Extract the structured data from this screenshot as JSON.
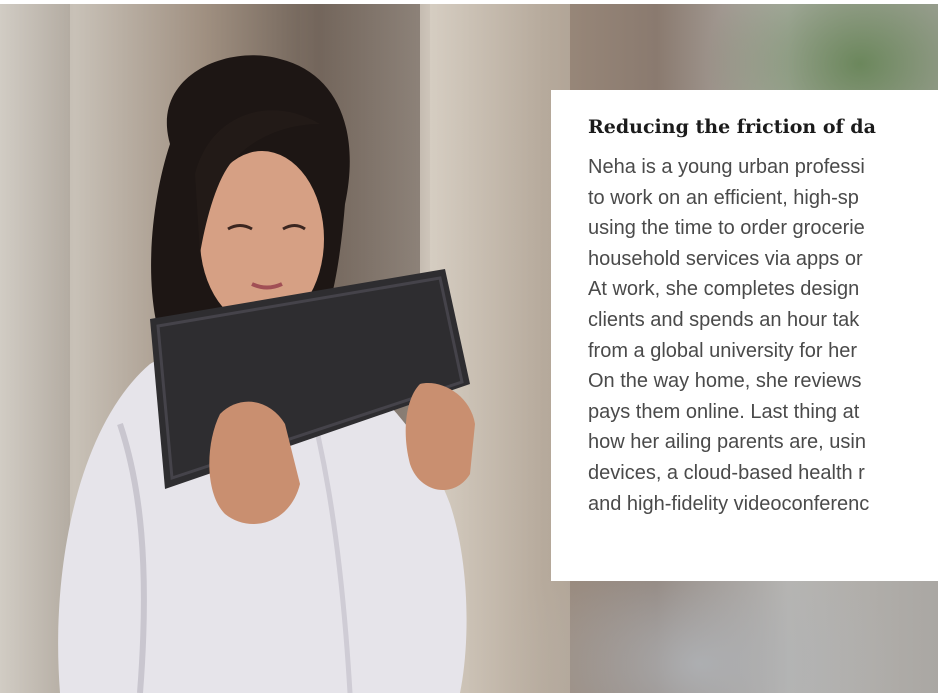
{
  "card": {
    "title": "Reducing the friction of da",
    "lines": [
      "Neha is a young urban professi",
      "to work on an efficient, high-sp",
      "using the time to order grocerie",
      "household services via apps or",
      "At work, she completes design",
      "clients and spends an hour tak",
      "from a global university for her",
      "On the way home, she reviews",
      "pays them online. Last thing at",
      "how her ailing parents are, usin",
      "devices, a cloud-based health r",
      "and high-fidelity videoconferenc"
    ]
  },
  "colors": {
    "card_background": "#ffffff",
    "title_color": "#1b1b1b",
    "body_color": "#4a4a4a"
  }
}
